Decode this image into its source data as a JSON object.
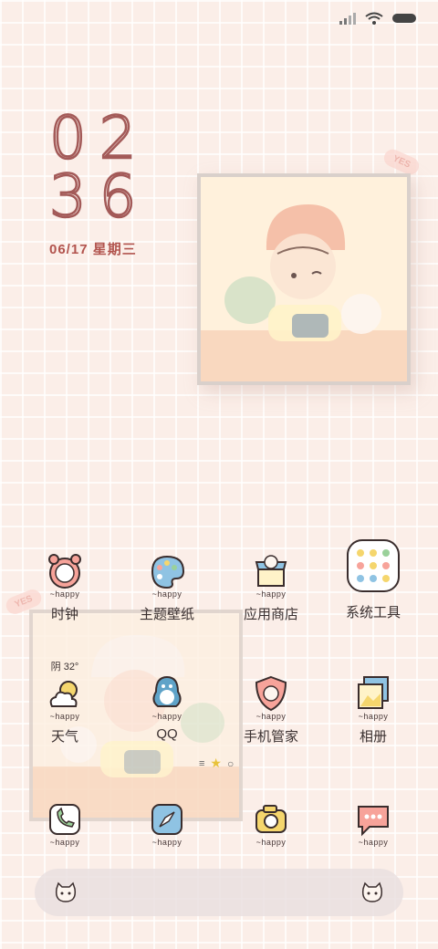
{
  "status_bar": {
    "signal_icon": "signal-icon",
    "wifi_icon": "wifi-icon",
    "battery_icon": "battery-icon"
  },
  "clock": {
    "hour": "02",
    "minute": "36",
    "date": "06/17 星期三"
  },
  "apps": [
    {
      "label": "时钟",
      "happy": "~happy",
      "icon": "alarm-clock-icon"
    },
    {
      "label": "主题壁纸",
      "happy": "~happy",
      "icon": "palette-icon"
    },
    {
      "label": "应用商店",
      "happy": "~happy",
      "icon": "shop-icon"
    },
    {
      "label": "系统工具",
      "happy": "",
      "icon": "folder-icon"
    },
    {
      "label": "天气",
      "happy": "~happy",
      "icon": "weather-icon",
      "temp": "阴 32°"
    },
    {
      "label": "QQ",
      "happy": "~happy",
      "icon": "penguin-icon"
    },
    {
      "label": "手机管家",
      "happy": "~happy",
      "icon": "shield-icon"
    },
    {
      "label": "相册",
      "happy": "~happy",
      "icon": "gallery-icon"
    },
    {
      "label": "",
      "happy": "~happy",
      "icon": "phone-icon"
    },
    {
      "label": "",
      "happy": "~happy",
      "icon": "compass-icon"
    },
    {
      "label": "",
      "happy": "~happy",
      "icon": "camera-icon"
    },
    {
      "label": "",
      "happy": "~happy",
      "icon": "message-icon"
    }
  ],
  "stickers": {
    "tag1": "YES",
    "tag2": "YES"
  },
  "colors": {
    "accent": "#b2544e",
    "background": "#fbeee8"
  }
}
